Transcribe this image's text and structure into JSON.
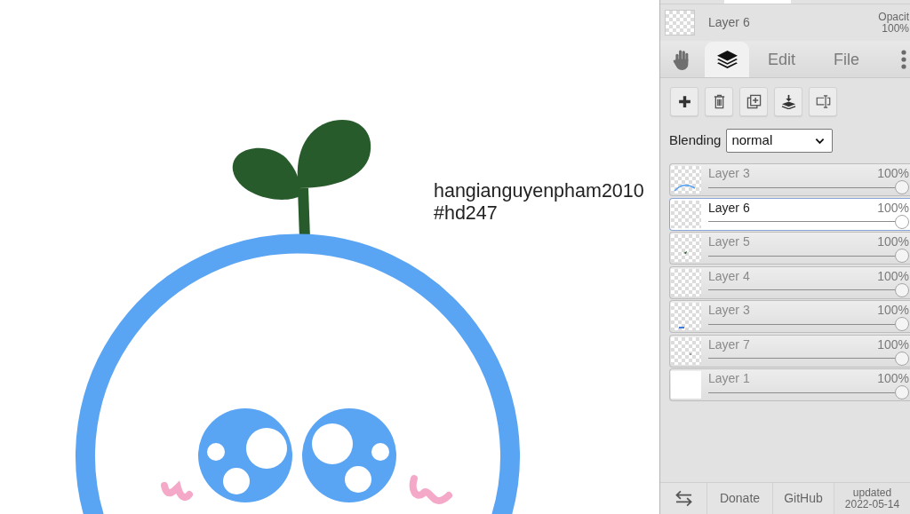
{
  "canvas": {
    "text_lines": [
      "hangianguyenpham2010",
      "#hd247"
    ]
  },
  "panel": {
    "current_layer": {
      "name": "Layer 6",
      "transparent": true,
      "opacity_label": "Opacit",
      "opacity_value": "100%"
    },
    "tabs": [
      {
        "kind": "icon",
        "selected": false
      },
      {
        "kind": "icon",
        "selected": true
      },
      {
        "kind": "text",
        "label": "Edit",
        "selected": false
      },
      {
        "kind": "text",
        "label": "File",
        "selected": false
      }
    ],
    "blending": {
      "label": "Blending",
      "value": "normal"
    },
    "layers": [
      {
        "name": "Layer 3",
        "opacity": "100%",
        "level": 1,
        "selected": false,
        "transparent": true
      },
      {
        "name": "Layer 6",
        "opacity": "100%",
        "level": 1,
        "selected": true,
        "transparent": true
      },
      {
        "name": "Layer 5",
        "opacity": "100%",
        "level": 1,
        "selected": false,
        "transparent": true
      },
      {
        "name": "Layer 4",
        "opacity": "100%",
        "level": 1,
        "selected": false,
        "transparent": true
      },
      {
        "name": "Layer 3",
        "opacity": "100%",
        "level": 1,
        "selected": false,
        "transparent": true
      },
      {
        "name": "Layer 7",
        "opacity": "100%",
        "level": 1,
        "selected": false,
        "transparent": true
      },
      {
        "name": "Layer 1",
        "opacity": "100%",
        "level": 1,
        "selected": false,
        "transparent": false
      }
    ],
    "footer": {
      "buttons": [
        {
          "kind": "icon"
        },
        {
          "kind": "text",
          "label": "Donate"
        },
        {
          "kind": "text",
          "label": "GitHub"
        }
      ],
      "updated_label": "updated",
      "updated_date": "2022-05-14"
    }
  }
}
